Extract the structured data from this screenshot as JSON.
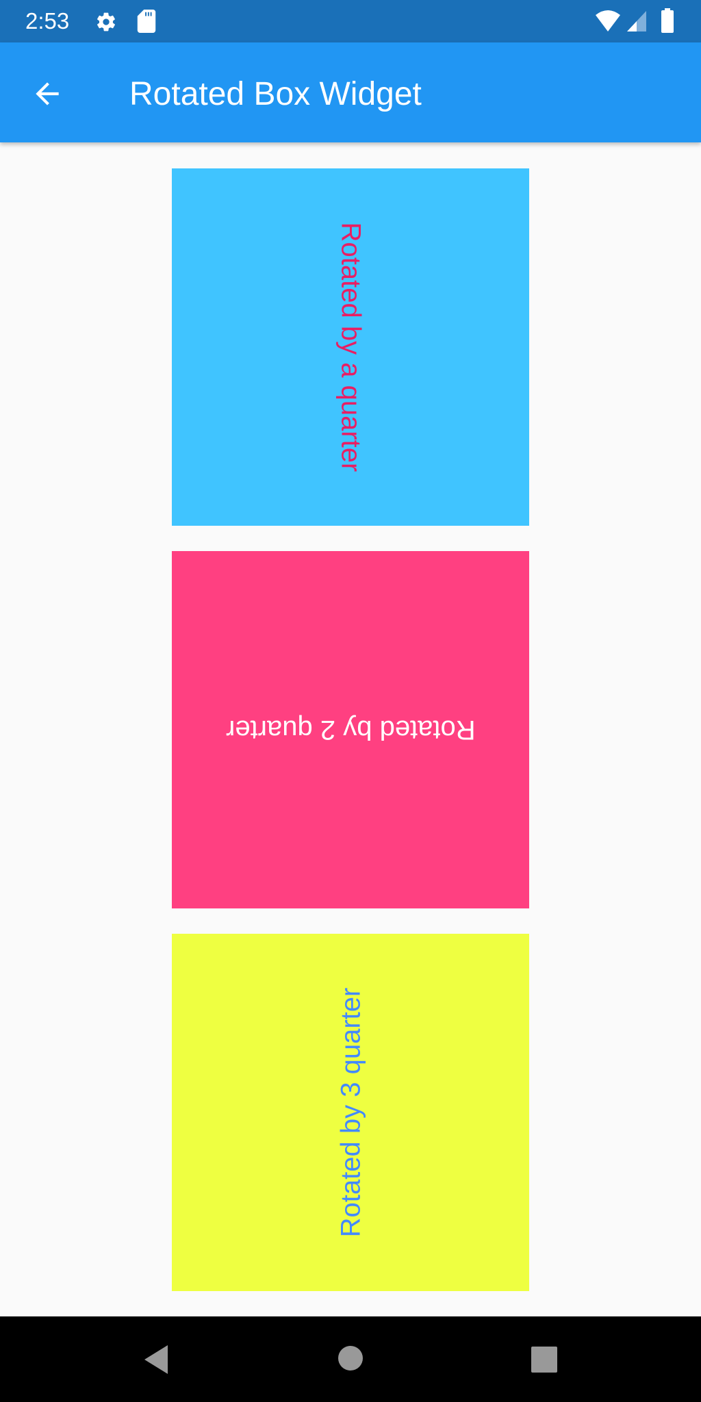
{
  "status_bar": {
    "time": "2:53",
    "icons": [
      "gear-icon",
      "sd-card-icon",
      "wifi-icon",
      "signal-icon",
      "battery-icon"
    ]
  },
  "app_bar": {
    "back_icon": "arrow-back-icon",
    "title": "Rotated Box Widget",
    "background": "#2196f3"
  },
  "boxes": [
    {
      "label": "Rotated by a quarter",
      "quarter_turns": 1,
      "background": "#40c4ff",
      "text_color": "#e91e63"
    },
    {
      "label": "Rotated by 2 quarter",
      "quarter_turns": 2,
      "background": "#ff4081",
      "text_color": "#ffffff"
    },
    {
      "label": "Rotated by 3 quarter",
      "quarter_turns": 3,
      "background": "#eeff41",
      "text_color": "#448aff"
    }
  ],
  "nav_bar": {
    "buttons": [
      "back",
      "home",
      "recents"
    ]
  }
}
